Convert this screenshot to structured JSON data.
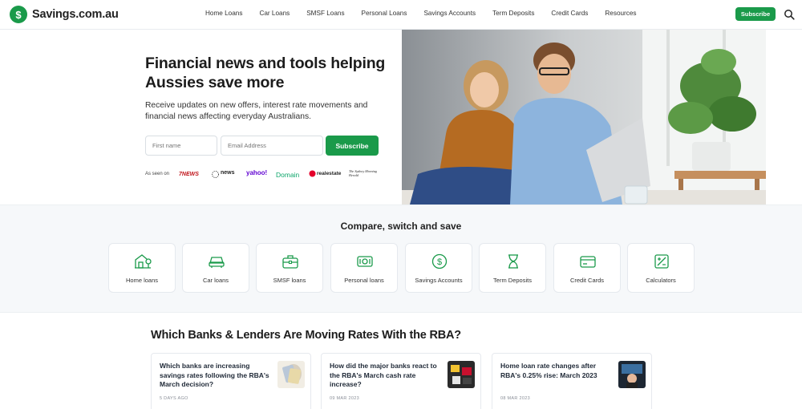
{
  "header": {
    "logo_text": "Savings.com.au",
    "logo_glyph": "$",
    "nav": [
      "Home Loans",
      "Car Loans",
      "SMSF Loans",
      "Personal Loans",
      "Savings Accounts",
      "Term Deposits",
      "Credit Cards",
      "Resources"
    ],
    "subscribe_label": "Subscribe"
  },
  "hero": {
    "title": "Financial news and tools helping Aussies save more",
    "description": "Receive updates on new offers, interest rate movements and financial news affecting everyday Australians.",
    "first_name_placeholder": "First name",
    "email_placeholder": "Email Address",
    "subscribe_label": "Subscribe",
    "as_seen_on": "As seen on",
    "media": [
      "7NEWS",
      "news",
      "yahoo!",
      "Domain",
      "realestate",
      "The Sydney Morning Herald"
    ]
  },
  "compare": {
    "title": "Compare, switch and save",
    "items": [
      {
        "label": "Home loans",
        "icon": "house-icon"
      },
      {
        "label": "Car loans",
        "icon": "car-icon"
      },
      {
        "label": "SMSF loans",
        "icon": "briefcase-icon"
      },
      {
        "label": "Personal loans",
        "icon": "cash-icon"
      },
      {
        "label": "Savings Accounts",
        "icon": "dollar-circle-icon"
      },
      {
        "label": "Term Deposits",
        "icon": "hourglass-icon"
      },
      {
        "label": "Credit Cards",
        "icon": "credit-card-icon"
      },
      {
        "label": "Calculators",
        "icon": "calculator-icon"
      }
    ]
  },
  "rates": {
    "title": "Which Banks & Lenders Are Moving Rates With the RBA?",
    "articles": [
      {
        "title": "Which banks are increasing savings rates following the RBA's March decision?",
        "date": "5 DAYS AGO"
      },
      {
        "title": "How did the major banks react to the RBA's March cash rate increase?",
        "date": "09 MAR 2023"
      },
      {
        "title": "Home loan rate changes after RBA's 0.25% rise: March 2023",
        "date": "08 MAR 2023"
      }
    ]
  },
  "colors": {
    "brand": "#1a9a4a",
    "text": "#1f2937",
    "section_bg": "#f6f8fa"
  }
}
